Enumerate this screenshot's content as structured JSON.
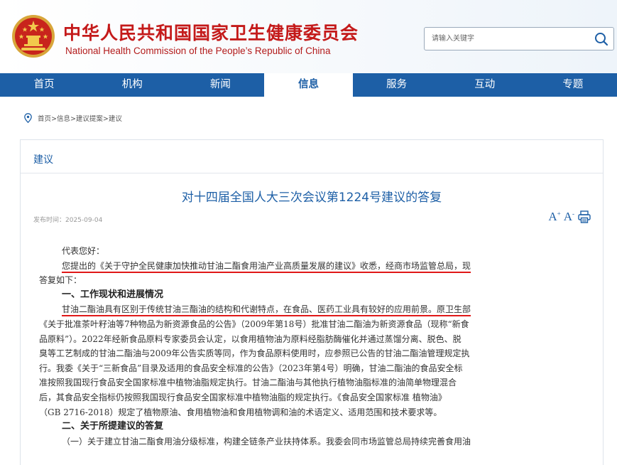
{
  "header": {
    "title_cn": "中华人民共和国国家卫生健康委员会",
    "title_en": "National Health Commission of the People’s Republic of China",
    "search_placeholder": "请输入关键字",
    "colors": {
      "brand_red": "#c41a1a",
      "nav_blue": "#1d5fa6",
      "underline_red": "#e01818"
    }
  },
  "nav": {
    "items": [
      {
        "label": "首页"
      },
      {
        "label": "机构"
      },
      {
        "label": "新闻"
      },
      {
        "label": "信息",
        "active": true
      },
      {
        "label": "服务"
      },
      {
        "label": "互动"
      },
      {
        "label": "专题"
      }
    ]
  },
  "breadcrumb": {
    "text": "首页>信息>建议提案>建议"
  },
  "article": {
    "section": "建议",
    "title": "对十四届全国人大三次会议第1224号建议的答复",
    "pub_date": "发布时间：2025-09-04",
    "font_large": "A",
    "font_small": "A",
    "plus": "+",
    "minus": "-",
    "lines": [
      "代表您好：",
      "您提出的《关于守护全民健康加快推动甘油二酯食用油产业高质量发展的建议》收悉，经商市场监管总局，现",
      "答复如下：",
      "一、工作现状和进展情况",
      "甘油二酯油具有区别于传统甘油三酯油的结构和代谢特点，在食品、医药工业具有较好的应用前景。原卫生部",
      "《关于批准茶叶籽油等7种物品为新资源食品的公告》（2009年第18号）批准甘油二酯油为新资源食品（现称“新食",
      "品原料”）。2022年经新食品原料专家委员会认定，以食用植物油为原料经脂肪酶催化并通过蒸馏分离、脱色、脱",
      "臭等工艺制成的甘油二酯油与2009年公告实质等同，作为食品原料使用时，应参照已公告的甘油二酯油管理规定执",
      "行。我委《关于“三新食品”目录及适用的食品安全标准的公告》（2023年第4号）明确，甘油二酯油的食品安全标",
      "准按照我国现行食品安全国家标准中植物油脂规定执行。甘油二酯油与其他执行植物油脂标准的油简单物理混合",
      "后，其食品安全指标仍按照我国现行食品安全国家标准中植物油脂的规定执行。《食品安全国家标准 植物油》",
      "（GB 2716-2018）规定了植物原油、食用植物油和食用植物调和油的术语定义、适用范围和技术要求等。",
      "二、关于所提建议的答复",
      "（一）关于建立甘油二酯食用油分级标准，构建全链条产业扶持体系。我委会同市场监管总局持续完善食用油"
    ]
  }
}
